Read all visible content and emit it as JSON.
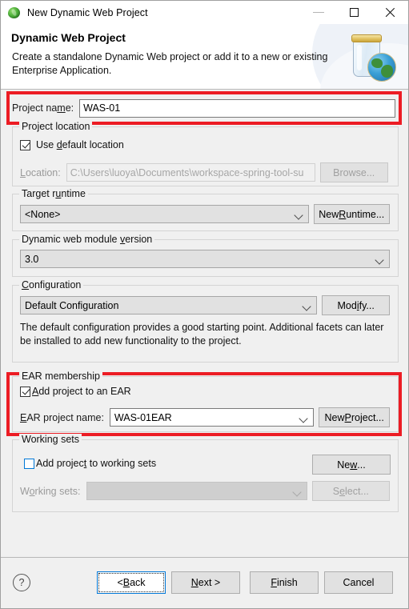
{
  "window": {
    "title": "New Dynamic Web Project",
    "icon": "eclipse-leaf-icon",
    "controls": {
      "minimize": "–",
      "maximize": "□",
      "close": "✕"
    }
  },
  "banner": {
    "title": "Dynamic Web Project",
    "description": "Create a standalone Dynamic Web project or add it to a new or existing Enterprise Application.",
    "art": "jar-with-globe-icon"
  },
  "project_name": {
    "label": "Project name:",
    "value": "WAS-01",
    "highlighted": true
  },
  "project_location": {
    "group_label": "Project location",
    "use_default_label": "Use default location",
    "use_default_checked": true,
    "location_label": "Location:",
    "location_value": "C:\\Users\\luoya\\Documents\\workspace-spring-tool-su",
    "browse_label": "Browse..."
  },
  "target_runtime": {
    "group_label": "Target runtime",
    "value": "<None>",
    "new_runtime_label": "New Runtime..."
  },
  "module_version": {
    "group_label": "Dynamic web module version",
    "value": "3.0"
  },
  "configuration": {
    "group_label": "Configuration",
    "value": "Default Configuration",
    "modify_label": "Modify...",
    "help_text": "The default configuration provides a good starting point. Additional facets can later be installed to add new functionality to the project."
  },
  "ear_membership": {
    "group_label": "EAR membership",
    "add_to_ear_label": "Add project to an EAR",
    "add_to_ear_checked": true,
    "ear_project_label": "EAR project name:",
    "ear_project_value": "WAS-01EAR",
    "new_project_label": "New Project...",
    "highlighted": true
  },
  "working_sets": {
    "group_label": "Working sets",
    "add_to_working_sets_label": "Add project to working sets",
    "add_to_working_sets_checked": false,
    "working_sets_label": "Working sets:",
    "working_sets_value": "",
    "new_label": "New...",
    "select_label": "Select..."
  },
  "footer": {
    "help": "?",
    "back": "< Back",
    "next": "Next >",
    "finish": "Finish",
    "cancel": "Cancel"
  },
  "colors": {
    "highlight": "#ec1c24",
    "dialog_bg": "#f0f0f0",
    "focus_border": "#0078d7"
  }
}
